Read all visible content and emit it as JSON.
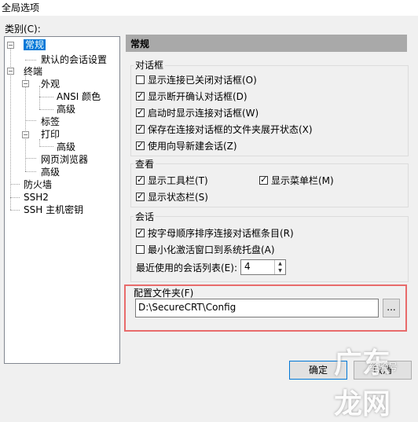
{
  "window": {
    "title": "全局选项"
  },
  "category_label": "类别(C):",
  "tree": {
    "items": [
      {
        "label": "常规"
      },
      {
        "label": "默认的会话设置"
      },
      {
        "label": "终端"
      },
      {
        "label": "外观"
      },
      {
        "label": "ANSI 颜色"
      },
      {
        "label": "高级"
      },
      {
        "label": "标签"
      },
      {
        "label": "打印"
      },
      {
        "label": "高级"
      },
      {
        "label": "网页浏览器"
      },
      {
        "label": "高级"
      },
      {
        "label": "防火墙"
      },
      {
        "label": "SSH2"
      },
      {
        "label": "SSH 主机密钥"
      }
    ]
  },
  "panel": {
    "title": "常规"
  },
  "dialogs_group": {
    "title": "对话框",
    "options": [
      {
        "label": "显示连接已关闭对话框(O)",
        "checked": false
      },
      {
        "label": "显示断开确认对话框(D)",
        "checked": true
      },
      {
        "label": "启动时显示连接对话框(W)",
        "checked": true
      },
      {
        "label": "保存在连接对话框的文件夹展开状态(X)",
        "checked": true
      },
      {
        "label": "使用向导新建会话(Z)",
        "checked": true
      }
    ]
  },
  "view_group": {
    "title": "查看",
    "options": [
      {
        "label": "显示工具栏(T)",
        "checked": true
      },
      {
        "label": "显示菜单栏(M)",
        "checked": true
      },
      {
        "label": "显示状态栏(S)",
        "checked": true
      }
    ]
  },
  "session_group": {
    "title": "会话",
    "options": [
      {
        "label": "按字母顺序排序连接对话框条目(R)",
        "checked": true
      },
      {
        "label": "最小化激活窗口到系统托盘(A)",
        "checked": false
      }
    ],
    "recent_label": "最近使用的会话列表(E):",
    "recent_value": "4"
  },
  "config_folder": {
    "title": "配置文件夹(F)",
    "path": "D:\\SecureCRT\\Config",
    "browse_label": "..."
  },
  "buttons": {
    "ok": "确定",
    "cancel": "取消"
  },
  "watermark": {
    "logo": "广东龙网",
    "small": "经验号"
  }
}
